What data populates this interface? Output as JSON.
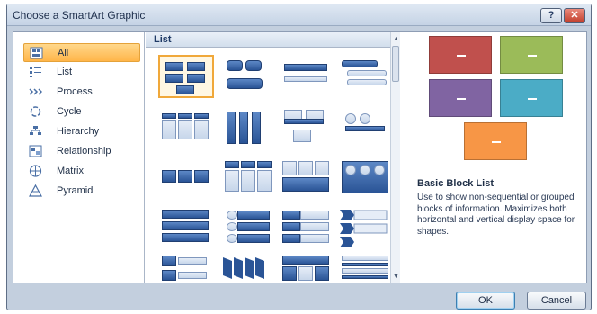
{
  "window": {
    "title": "Choose a SmartArt Graphic",
    "help_glyph": "?",
    "close_glyph": "✕"
  },
  "categories": [
    {
      "label": "All",
      "icon": "all-icon",
      "selected": true
    },
    {
      "label": "List",
      "icon": "list-icon"
    },
    {
      "label": "Process",
      "icon": "process-icon"
    },
    {
      "label": "Cycle",
      "icon": "cycle-icon"
    },
    {
      "label": "Hierarchy",
      "icon": "hierarchy-icon"
    },
    {
      "label": "Relationship",
      "icon": "relationship-icon"
    },
    {
      "label": "Matrix",
      "icon": "matrix-icon"
    },
    {
      "label": "Pyramid",
      "icon": "pyramid-icon"
    }
  ],
  "layout_list": {
    "header": "List"
  },
  "preview": {
    "title": "Basic Block List",
    "description": "Use to show non-sequential or grouped blocks of information. Maximizes both horizontal and vertical display space for shapes.",
    "colors": [
      "#c0504d",
      "#9bbb59",
      "#8064a2",
      "#4bacc6",
      "#f79646"
    ]
  },
  "buttons": {
    "ok": "OK",
    "cancel": "Cancel"
  },
  "colors": {
    "accent_selected": "#ffb549",
    "shape_blue": "#2a5496"
  }
}
